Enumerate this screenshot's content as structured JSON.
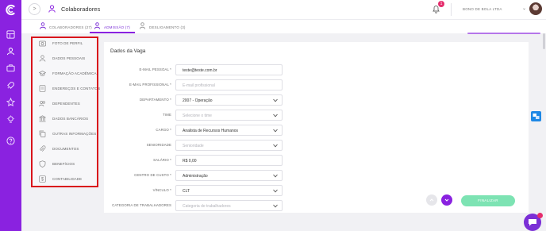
{
  "header": {
    "title": "Colaboradores",
    "notification_count": "1",
    "company": "BONO DE BOLA LTDA"
  },
  "tabs": [
    {
      "label": "COLABORADORES (27)",
      "active": false
    },
    {
      "label": "ADMISSÃO (7)",
      "active": true
    },
    {
      "label": "DESLIGAMENTO (3)",
      "active": false
    }
  ],
  "menu": [
    {
      "label": "FOTO DE PERFIL",
      "icon": "camera-icon"
    },
    {
      "label": "DADOS PESSOAIS",
      "icon": "user-icon"
    },
    {
      "label": "FORMAÇÃO ACADÊMICA",
      "icon": "graduation-icon"
    },
    {
      "label": "ENDEREÇOS E CONTATOS",
      "icon": "address-icon"
    },
    {
      "label": "DEPENDENTES",
      "icon": "users-icon"
    },
    {
      "label": "DADOS BANCÁRIOS",
      "icon": "bank-icon"
    },
    {
      "label": "OUTRAS INFORMAÇÕES",
      "icon": "copy-icon"
    },
    {
      "label": "DOCUMENTOS",
      "icon": "clip-icon"
    },
    {
      "label": "BENEFÍCIOS",
      "icon": "shield-icon"
    },
    {
      "label": "CONTABILIDADE",
      "icon": "dollar-icon"
    }
  ],
  "form": {
    "section_title": "Dados da Vaga",
    "fields": [
      {
        "label": "E-MAIL PESSOAL *",
        "value": "teste@teste.com.br",
        "placeholder": false,
        "select": false
      },
      {
        "label": "E-MAIL PROFISSIONAL *",
        "value": "E-mail profissional",
        "placeholder": true,
        "select": false
      },
      {
        "label": "DEPARTAMENTO *",
        "value": "2007 - Operação",
        "placeholder": false,
        "select": true
      },
      {
        "label": "TIME",
        "value": "Selecione o time",
        "placeholder": true,
        "select": true
      },
      {
        "label": "CARGO *",
        "value": "Analista de Recursos Humanos",
        "placeholder": false,
        "select": true
      },
      {
        "label": "SENIORIDADE",
        "value": "Senioridade",
        "placeholder": true,
        "select": true
      },
      {
        "label": "SALÁRIO *",
        "value": "R$ 0,00",
        "placeholder": false,
        "select": false
      },
      {
        "label": "CENTRO DE CUSTO *",
        "value": "Administração",
        "placeholder": false,
        "select": true
      },
      {
        "label": "VÍNCULO *",
        "value": "CLT",
        "placeholder": false,
        "select": true
      },
      {
        "label": "CATEGORIA DE TRABALHADORES",
        "value": "Categoria de trabalhadores",
        "placeholder": true,
        "select": true
      }
    ]
  },
  "actions": {
    "finish_label": "FINALIZAR"
  },
  "colors": {
    "brand": "#8a22e0",
    "finish": "#7de3b3",
    "highlight_box": "#d9131b"
  }
}
